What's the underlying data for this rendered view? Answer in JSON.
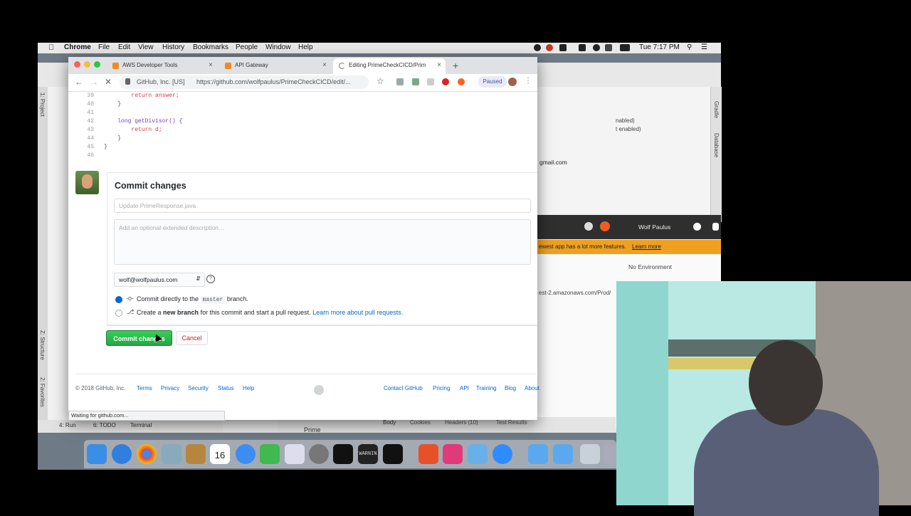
{
  "menubar": {
    "app": "Chrome",
    "items": [
      "File",
      "Edit",
      "View",
      "History",
      "Bookmarks",
      "People",
      "Window",
      "Help"
    ],
    "clock": "Tue 7:17 PM"
  },
  "browser": {
    "tabs": [
      {
        "label": "AWS Developer Tools"
      },
      {
        "label": "API Gateway"
      },
      {
        "label": "Editing PrimeCheckCICD/Prim"
      }
    ],
    "site_identity": "GitHub, Inc. [US]",
    "url": "https://github.com/wolfpaulus/PrimeCheckCICD/edit/...",
    "profile_status": "Paused"
  },
  "code": {
    "lines": [
      {
        "n": "39",
        "text": "        return answer;"
      },
      {
        "n": "40",
        "text": "    }"
      },
      {
        "n": "41",
        "text": ""
      },
      {
        "n": "42",
        "text": "    long getDivisor() {"
      },
      {
        "n": "43",
        "text": "        return d;"
      },
      {
        "n": "44",
        "text": "    }"
      },
      {
        "n": "45",
        "text": "}"
      },
      {
        "n": "46",
        "text": ""
      }
    ]
  },
  "commit": {
    "title": "Commit changes",
    "summary_placeholder": "Update PrimeResponse.java",
    "description_placeholder": "Add an optional extended description…",
    "email": "wolf@wolfpaulus.com",
    "option1_prefix": "Commit directly to the",
    "branch": "master",
    "option1_suffix": "branch.",
    "option2_prefix": "Create a",
    "option2_bold": "new branch",
    "option2_middle": "for this commit and start a pull request.",
    "option2_link": "Learn more about pull requests.",
    "commit_button": "Commit changes",
    "cancel_button": "Cancel"
  },
  "footer": {
    "copyright": "© 2018 GitHub, Inc.",
    "left_links": [
      "Terms",
      "Privacy",
      "Security",
      "Status",
      "Help"
    ],
    "right_links": [
      "Contact GitHub",
      "Pricing",
      "API",
      "Training",
      "Blog",
      "About"
    ]
  },
  "status_bar": "Waiting for github.com...",
  "background_app": {
    "user": "Wolf Paulus",
    "environment": "No Environment",
    "banner": "ewest app has a lot more features.",
    "banner_link": "Learn more",
    "email_fragment": "gmail.com",
    "url_fragment": "est-2.amazonaws.com/Prod/",
    "enabled1": "nabled)",
    "enabled2": "t enabled)",
    "tabs": [
      "Body",
      "Cookies",
      "Headers (10)",
      "Test Results"
    ],
    "request_name": "Prime",
    "ide_tools": [
      "4: Run",
      "6: TODO",
      "Terminal"
    ],
    "ide_side": [
      "1: Project",
      "Z: Structure",
      "2: Favorites"
    ],
    "ide_right": [
      "Gradle",
      "Database"
    ]
  },
  "dock": {
    "calendar_day": "16",
    "console_text": "WARNIN"
  },
  "colors": {
    "commit_green": "#28a745",
    "cancel_red": "#cb2431",
    "link_blue": "#0366d6",
    "postman_orange": "#f0a020"
  }
}
